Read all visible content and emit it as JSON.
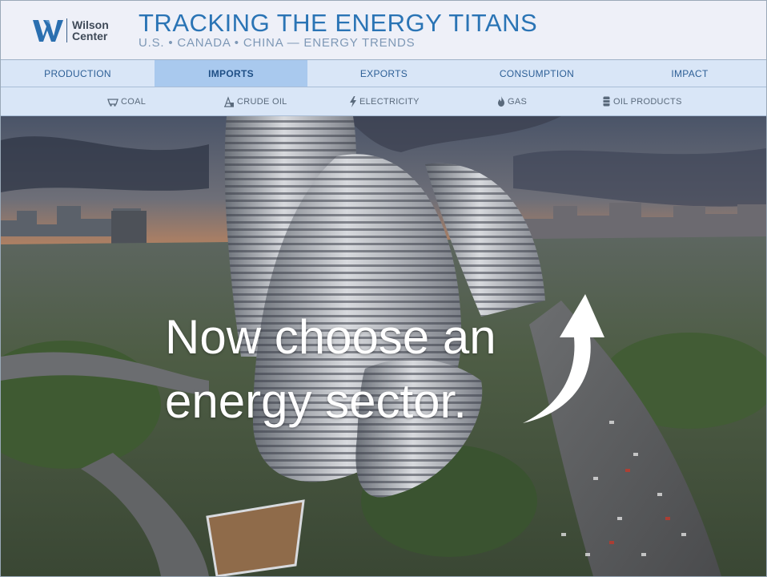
{
  "header": {
    "logo_line1": "Wilson",
    "logo_line2": "Center",
    "title": "TRACKING THE ENERGY TITANS",
    "subtitle": "U.S. • CANADA • CHINA — ENERGY TRENDS"
  },
  "nav": {
    "tabs": [
      {
        "label": "PRODUCTION",
        "active": false
      },
      {
        "label": "IMPORTS",
        "active": true
      },
      {
        "label": "EXPORTS",
        "active": false
      },
      {
        "label": "CONSUMPTION",
        "active": false
      },
      {
        "label": "IMPACT",
        "active": false
      }
    ]
  },
  "subnav": {
    "items": [
      {
        "label": "COAL",
        "icon": "coal-cart-icon"
      },
      {
        "label": "CRUDE OIL",
        "icon": "oil-pump-icon"
      },
      {
        "label": "ELECTRICITY",
        "icon": "lightning-icon"
      },
      {
        "label": "GAS",
        "icon": "flame-icon"
      },
      {
        "label": "OIL PRODUCTS",
        "icon": "oil-barrel-icon"
      }
    ]
  },
  "hero": {
    "prompt_line1": "Now choose an",
    "prompt_line2": "energy sector.",
    "image_subject": "aerial-city-skyline-photo"
  },
  "colors": {
    "title_blue": "#2a74b5",
    "nav_bg": "#d9e6f7",
    "nav_active_bg": "#a9c9ee",
    "header_bg": "#eef0f8"
  }
}
